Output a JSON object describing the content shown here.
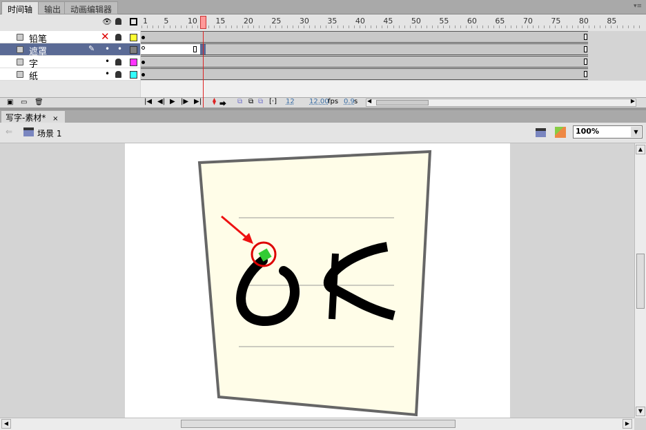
{
  "panel_tabs": [
    {
      "label": "时间轴"
    },
    {
      "label": "输出"
    },
    {
      "label": "动画编辑器"
    }
  ],
  "ruler": {
    "labels": [
      "1",
      "5",
      "10",
      "15",
      "20",
      "25",
      "30",
      "35",
      "40",
      "45",
      "50",
      "55",
      "60",
      "65",
      "70",
      "75",
      "80",
      "85"
    ],
    "current_frame": 12,
    "last_frame": 80
  },
  "layers": [
    {
      "name": "铅笔",
      "color": "#ffff33",
      "visible": false,
      "locked": true
    },
    {
      "name": "遮罩",
      "color": "#808080",
      "selected": true
    },
    {
      "name": "字",
      "color": "#ff33ff",
      "locked": true
    },
    {
      "name": "纸",
      "color": "#33ffff",
      "locked": true
    }
  ],
  "status": {
    "frame": "12",
    "fps": "12.00",
    "fps_unit": "fps",
    "time": "0.9",
    "time_unit": "s"
  },
  "doc_tab": {
    "label": "写字-素材*",
    "close": "×"
  },
  "scene": {
    "label": "场景 1"
  },
  "zoom": {
    "value": "100%"
  },
  "colors": {
    "accent": "#5a6a95",
    "playhead": "#e04040"
  }
}
